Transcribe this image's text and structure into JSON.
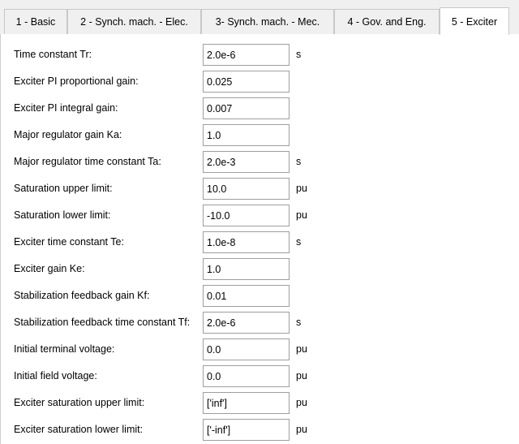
{
  "tabs": [
    {
      "label": "1 - Basic"
    },
    {
      "label": "2 - Synch. mach. - Elec."
    },
    {
      "label": "3- Synch. mach. - Mec."
    },
    {
      "label": "4 - Gov. and Eng."
    },
    {
      "label": "5 - Exciter"
    }
  ],
  "rows": [
    {
      "label": "Time constant Tr:",
      "value": "2.0e-6",
      "unit": "s"
    },
    {
      "label": "Exciter PI proportional gain:",
      "value": "0.025",
      "unit": ""
    },
    {
      "label": "Exciter PI integral gain:",
      "value": "0.007",
      "unit": ""
    },
    {
      "label": "Major regulator gain Ka:",
      "value": "1.0",
      "unit": ""
    },
    {
      "label": "Major regulator time constant Ta:",
      "value": "2.0e-3",
      "unit": "s"
    },
    {
      "label": "Saturation upper limit:",
      "value": "10.0",
      "unit": "pu"
    },
    {
      "label": "Saturation lower limit:",
      "value": "-10.0",
      "unit": "pu"
    },
    {
      "label": "Exciter time constant Te:",
      "value": "1.0e-8",
      "unit": "s"
    },
    {
      "label": "Exciter gain Ke:",
      "value": "1.0",
      "unit": ""
    },
    {
      "label": "Stabilization feedback gain Kf:",
      "value": "0.01",
      "unit": ""
    },
    {
      "label": "Stabilization feedback time constant Tf:",
      "value": "2.0e-6",
      "unit": "s"
    },
    {
      "label": "Initial terminal voltage:",
      "value": "0.0",
      "unit": "pu"
    },
    {
      "label": "Initial field voltage:",
      "value": "0.0",
      "unit": "pu"
    },
    {
      "label": "Exciter saturation upper limit:",
      "value": "['inf']",
      "unit": "pu"
    },
    {
      "label": "Exciter saturation lower limit:",
      "value": "['-inf']",
      "unit": "pu"
    }
  ]
}
